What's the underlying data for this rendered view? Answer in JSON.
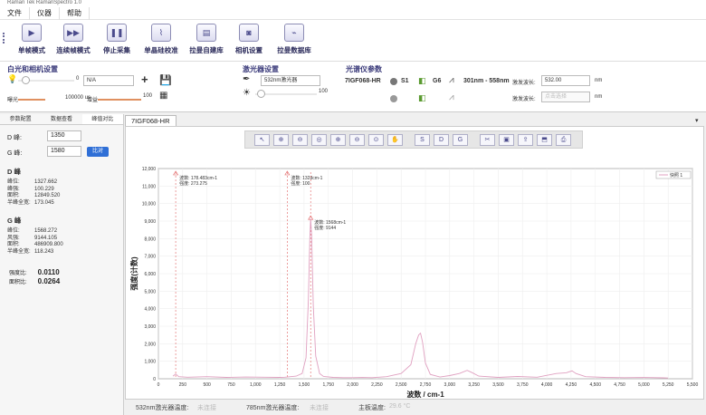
{
  "app": {
    "title": "Raman Tek RamanSpectro 1.0"
  },
  "menu": [
    "文件",
    "仪器",
    "帮助"
  ],
  "toolbar": [
    {
      "label": "单帧模式",
      "icon": "play-icon"
    },
    {
      "label": "连续帧模式",
      "icon": "fast-forward-icon"
    },
    {
      "label": "停止采集",
      "icon": "pause-icon"
    },
    {
      "label": "单晶硅校准",
      "icon": "calibration-icon"
    },
    {
      "label": "拉曼自建库",
      "icon": "library-build-icon"
    },
    {
      "label": "相机设置",
      "icon": "camera-icon"
    },
    {
      "label": "拉曼数据库",
      "icon": "database-icon"
    }
  ],
  "white_light": {
    "title": "白光和相机设置",
    "brightness": "0",
    "mode": "N/A",
    "exposure_label": "曝光",
    "exposure_value": "100000 us",
    "gain_label": "增益",
    "gain_value": "100"
  },
  "laser": {
    "title": "激光器设置",
    "laser_select": "532nm激光器",
    "power_value": "100"
  },
  "spectrometer": {
    "title": "光谱仪参数",
    "model": "7IGF068-HR",
    "s1": "S1",
    "g6": "G6",
    "range": "301nm - 558nm",
    "wavelength_label_1": "激发波长:",
    "wavelength_value_1": "532.00",
    "wavelength_unit_1": "nm",
    "wavelength_label_2": "激发波长:",
    "wavelength_value_2": "点击选择",
    "wavelength_unit_2": "nm"
  },
  "left_panel": {
    "tabs": [
      "参数配置",
      "数据查看",
      "峰值对比"
    ],
    "d_peak_label": "D 峰:",
    "d_peak_value": "1350",
    "g_peak_label": "G 峰:",
    "g_peak_value": "1580",
    "compare_button": "比对",
    "d_block": {
      "title": "D 峰",
      "rows": [
        {
          "k": "峰位:",
          "v": "1327.662"
        },
        {
          "k": "峰强:",
          "v": "100.229"
        },
        {
          "k": "面积:",
          "v": "12849.520"
        },
        {
          "k": "半峰全宽:",
          "v": "173.045"
        }
      ]
    },
    "g_block": {
      "title": "G 峰",
      "rows": [
        {
          "k": "峰位:",
          "v": "1568.272"
        },
        {
          "k": "风强:",
          "v": "9144.105"
        },
        {
          "k": "面积:",
          "v": "486909.800"
        },
        {
          "k": "半峰全宽:",
          "v": "118.243"
        }
      ]
    },
    "intensity_ratio_label": "强度比:",
    "intensity_ratio_value": "0.0110",
    "area_ratio_label": "面积比:",
    "area_ratio_value": "0.0264"
  },
  "document_tab": "7IGF068-HR",
  "plot_tools": [
    "pointer-icon",
    "zoom-in-icon",
    "zoom-out-icon",
    "target-icon",
    "zoom-x-icon",
    "zoom-y-icon",
    "zoom-fit-icon",
    "pan-icon",
    "s-icon",
    "d-icon",
    "g-icon",
    "cut-icon",
    "lock-icon",
    "export-icon",
    "save-icon",
    "print-icon"
  ],
  "plot_tool_labels": {
    "s": "S",
    "d": "D",
    "g": "G"
  },
  "chart_data": {
    "type": "line",
    "xlabel": "波数 / cm-1",
    "ylabel": "强度(计数)",
    "xlim": [
      0,
      5500
    ],
    "ylim": [
      0,
      12000
    ],
    "xticks": [
      "0",
      "250",
      "500",
      "750",
      "1,000",
      "1,250",
      "1,500",
      "1,750",
      "2,000",
      "2,250",
      "2,500",
      "2,750",
      "3,000",
      "3,250",
      "3,500",
      "3,750",
      "4,000",
      "4,250",
      "4,500",
      "4,750",
      "5,000",
      "5,250",
      "5,500"
    ],
    "yticks": [
      "0",
      "1,000",
      "2,000",
      "3,000",
      "4,000",
      "5,000",
      "6,000",
      "7,000",
      "8,000",
      "9,000",
      "10,000",
      "11,000",
      "12,000"
    ],
    "grid": true,
    "legend": "top-right",
    "series": [
      {
        "name": "快照 1",
        "color": "#e0a0c0",
        "x": [
          150,
          178,
          210,
          300,
          500,
          700,
          900,
          1100,
          1250,
          1300,
          1327,
          1360,
          1420,
          1480,
          1520,
          1545,
          1560,
          1568,
          1578,
          1595,
          1620,
          1660,
          1700,
          1800,
          1900,
          2000,
          2100,
          2200,
          2350,
          2500,
          2600,
          2650,
          2680,
          2700,
          2720,
          2750,
          2800,
          2900,
          3000,
          3100,
          3180,
          3230,
          3300,
          3500,
          3700,
          3900,
          4100,
          4200,
          4260,
          4300,
          4400,
          4600,
          4800,
          5000,
          5200,
          5250
        ],
        "y": [
          150,
          273,
          120,
          90,
          120,
          80,
          100,
          90,
          80,
          90,
          100,
          120,
          150,
          300,
          1200,
          4500,
          8000,
          9144,
          8200,
          4200,
          1300,
          300,
          130,
          80,
          60,
          60,
          70,
          60,
          120,
          300,
          800,
          2000,
          2500,
          2600,
          2100,
          900,
          250,
          100,
          180,
          300,
          480,
          350,
          150,
          80,
          130,
          90,
          300,
          340,
          450,
          300,
          120,
          80,
          60,
          70,
          50,
          40
        ]
      }
    ],
    "annotations": [
      {
        "x": 178,
        "y": 273,
        "text": "波数: 178.483cm-1\n强度: 273.275"
      },
      {
        "x": 1327,
        "y": 100,
        "text": "波数: 1328cm-1\n强度: 100"
      },
      {
        "x": 1568,
        "y": 9144,
        "text": "波数: 1568cm-1\n强度: 9144"
      }
    ]
  },
  "status": {
    "laser532_label": "532nm激光器温度:",
    "laser532_value": "未连接",
    "laser785_label": "785nm激光器温度:",
    "laser785_value": "未连接",
    "board_label": "主板温度:",
    "board_value": "29.6 °C"
  }
}
